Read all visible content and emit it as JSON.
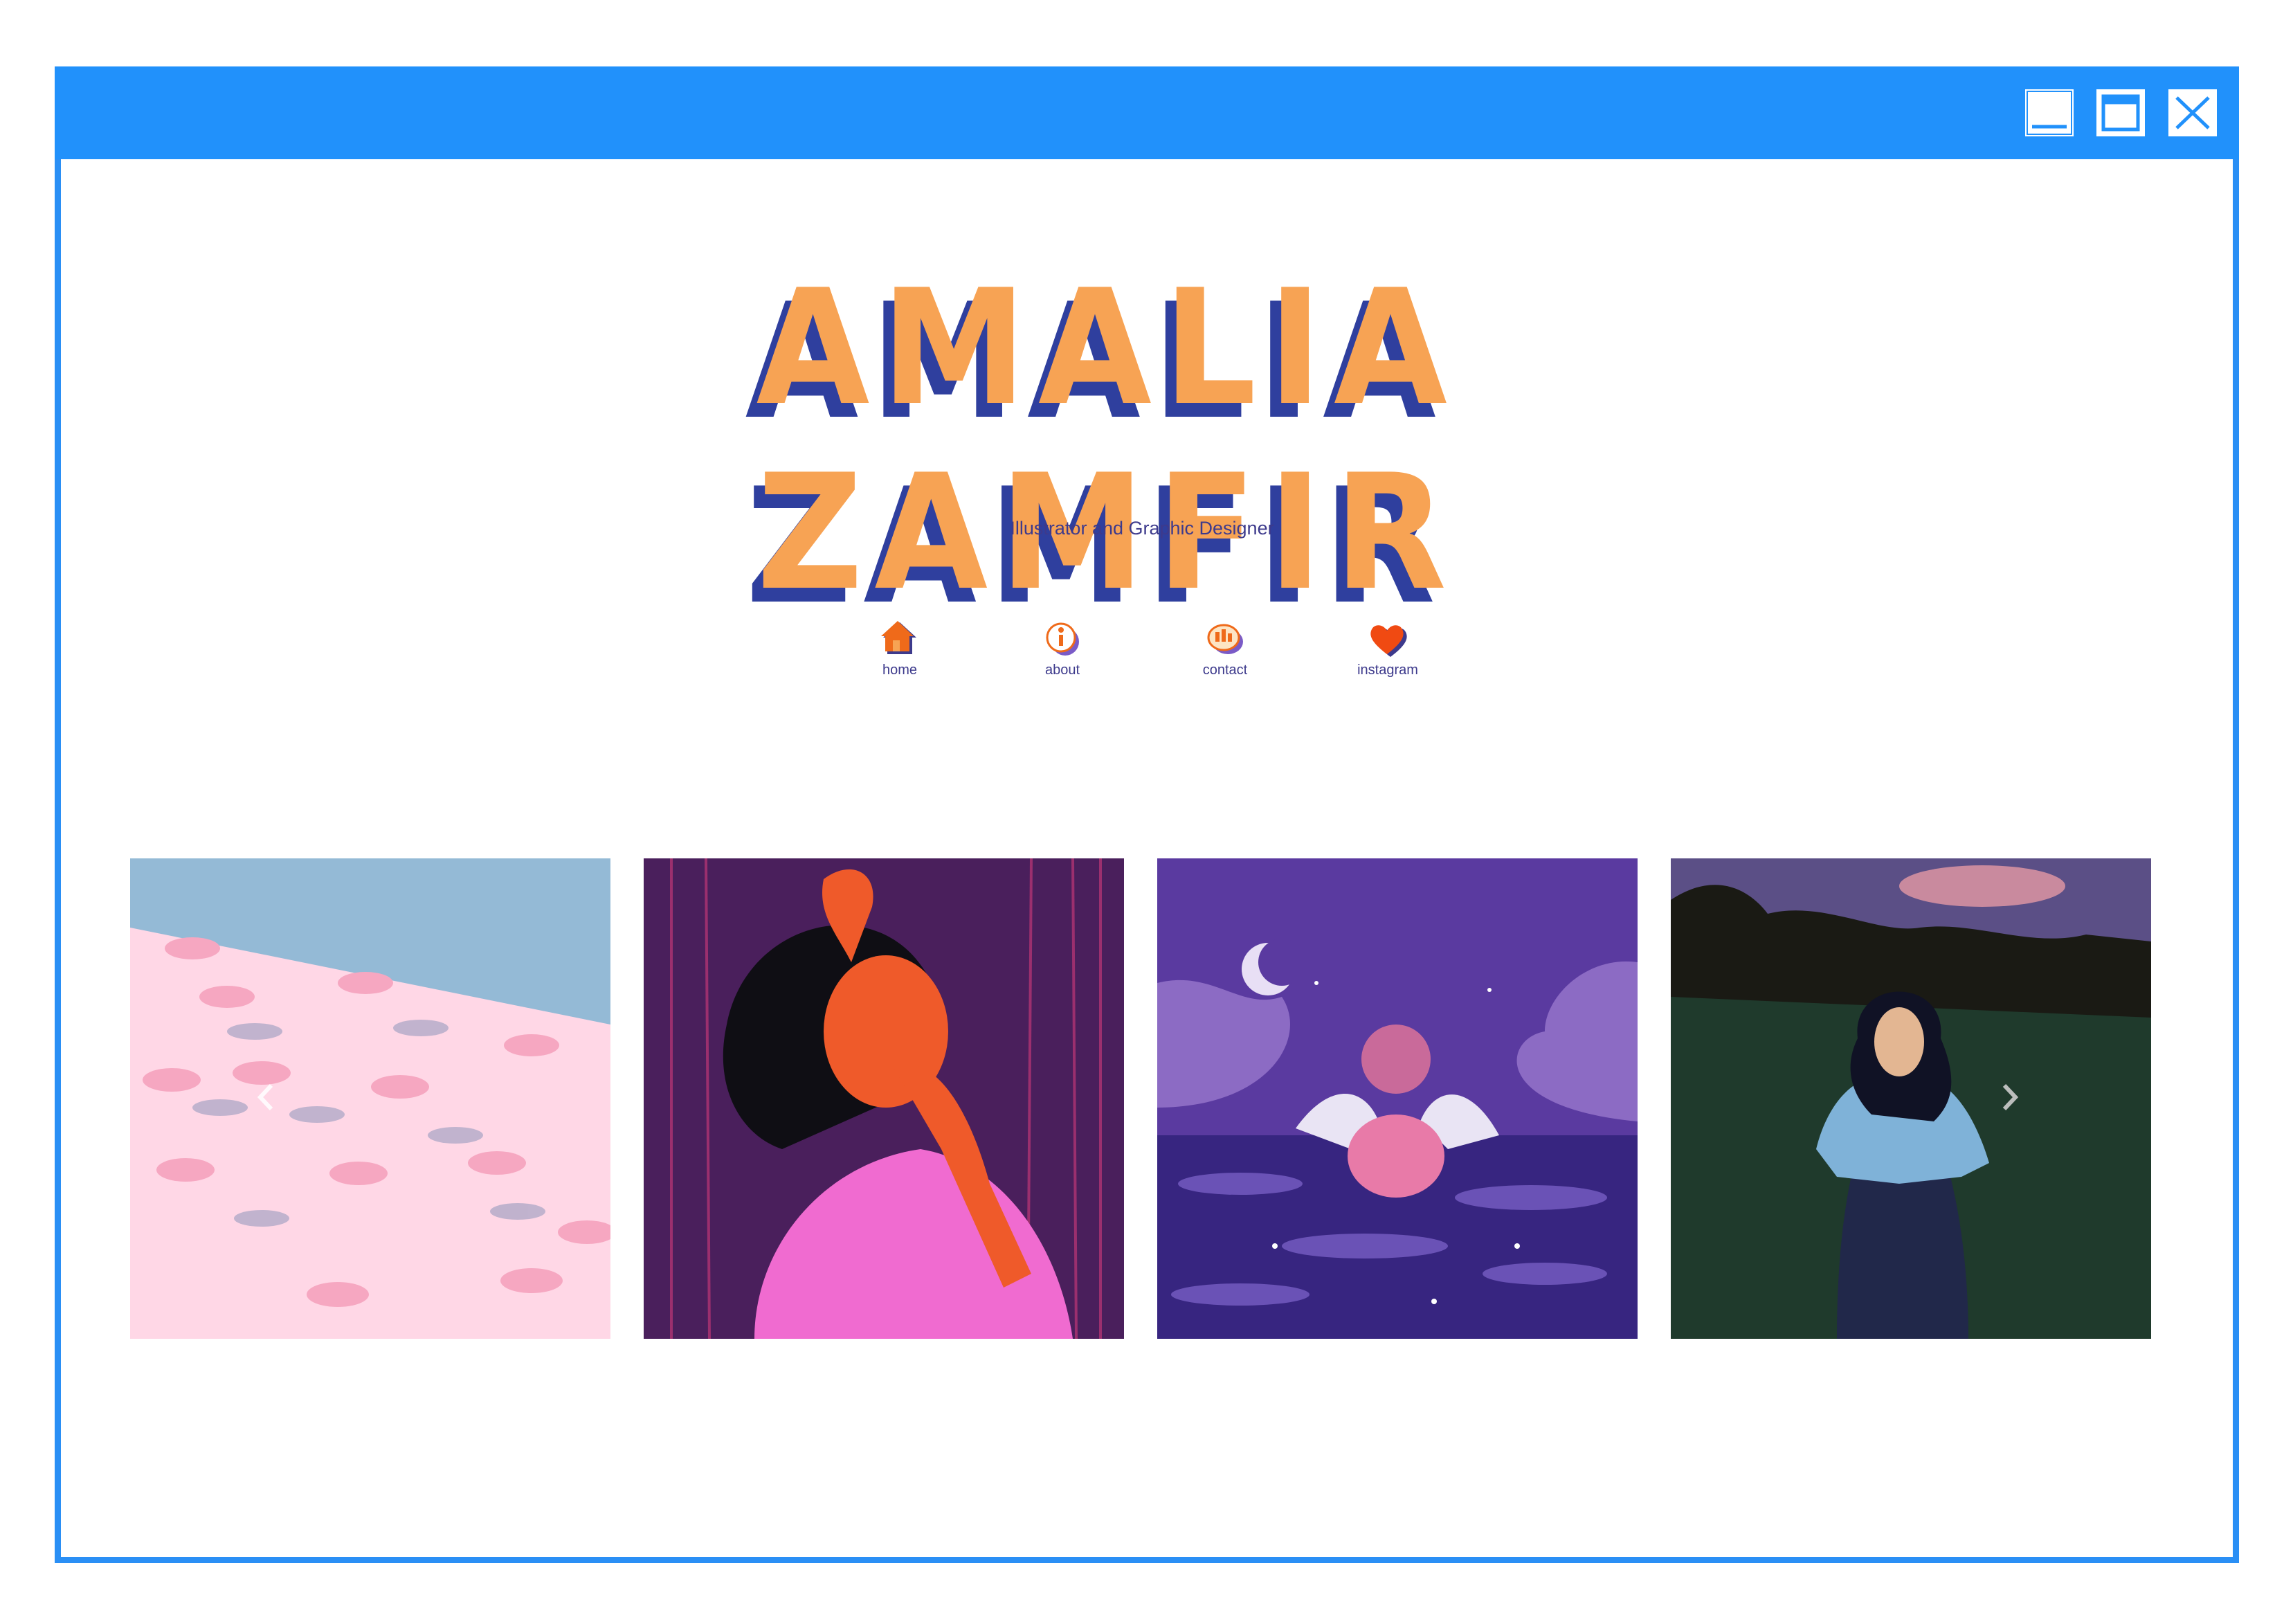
{
  "window": {
    "controls": {
      "minimize": "minimize-icon",
      "maximize": "maximize-icon",
      "close": "close-icon"
    },
    "titlebar_color": "#2191fb"
  },
  "header": {
    "logo_text": "AMALIA ZAMFIR",
    "subtitle": "Illustrator and Graphic Designer"
  },
  "nav": {
    "items": [
      {
        "label": "home",
        "icon": "house-icon"
      },
      {
        "label": "about",
        "icon": "info-icon"
      },
      {
        "label": "contact",
        "icon": "chat-icon"
      },
      {
        "label": "instagram",
        "icon": "heart-icon"
      }
    ]
  },
  "gallery": {
    "images": [
      {
        "name": "pink-beach-umbrellas-illustration"
      },
      {
        "name": "woman-hand-on-face-illustration"
      },
      {
        "name": "cupid-in-night-sea-illustration"
      },
      {
        "name": "woman-in-field-illustration"
      }
    ],
    "prev_icon": "chevron-left-icon",
    "next_icon": "chevron-right-icon"
  },
  "colors": {
    "accent": "#2191fb",
    "logo_orange": "#f7a354",
    "logo_blue": "#2f3f9e",
    "text": "#3d3a8c"
  }
}
